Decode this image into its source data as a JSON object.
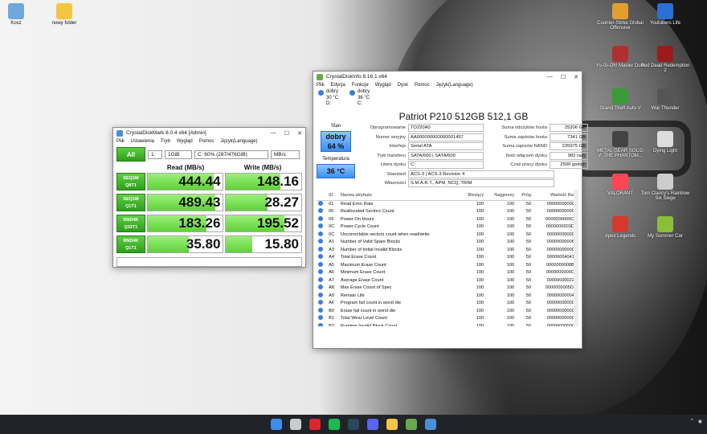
{
  "desktop": {
    "left_icons": [
      {
        "label": "Kosz",
        "color": "#6fa8dc"
      },
      {
        "label": "nowy folder",
        "color": "#f4c542"
      }
    ],
    "right_icons": [
      {
        "label": "Counter-Strike Global Offensive",
        "color": "#e0a030"
      },
      {
        "label": "Youtubers Life",
        "color": "#2b6fd8"
      },
      {
        "label": "Yu-Gi-Oh! Master Duel",
        "color": "#b03030"
      },
      {
        "label": "Red Dead Redemption 2",
        "color": "#9b1b1b"
      },
      {
        "label": "Grand Theft Auto V",
        "color": "#3a9a3a"
      },
      {
        "label": "War Thunder",
        "color": "#555555"
      },
      {
        "label": "METAL GEAR SOLID V: THE PHANTOM...",
        "color": "#444444"
      },
      {
        "label": "Dying Light",
        "color": "#dddddd"
      },
      {
        "label": "VALORANT",
        "color": "#ff4655"
      },
      {
        "label": "Tom Clancy's Rainbow Six Siege",
        "color": "#cccccc"
      },
      {
        "label": "Apex Legends",
        "color": "#d33a2c"
      },
      {
        "label": "My Summer Car",
        "color": "#8bbf3a"
      }
    ]
  },
  "cdm": {
    "title": "CrystalDiskMark 8.0.4 x64 [Admin]",
    "menu": [
      "Plik",
      "Ustawienia",
      "Tryb",
      "Wygląd",
      "Pomoc",
      "Język(Language)"
    ],
    "count": "1",
    "size": "1GiB",
    "drive": "C: 60% (287/476GiB)",
    "unit": "MB/s",
    "all_label": "All",
    "read_header": "Read (MB/s)",
    "write_header": "Write (MB/s)",
    "tests": [
      {
        "line1": "SEQ1M",
        "line2": "Q8T1",
        "read": "444.44",
        "write": "148.16",
        "read_fill": 0.88,
        "write_fill": 0.72
      },
      {
        "line1": "SEQ1M",
        "line2": "Q1T1",
        "read": "489.43",
        "write": "28.27",
        "read_fill": 0.9,
        "write_fill": 0.55
      },
      {
        "line1": "RND4K",
        "line2": "Q32T1",
        "read": "183.26",
        "write": "195.52",
        "read_fill": 0.78,
        "write_fill": 0.78
      },
      {
        "line1": "RND4K",
        "line2": "Q1T1",
        "read": "35.80",
        "write": "15.80",
        "read_fill": 0.55,
        "write_fill": 0.35
      }
    ]
  },
  "cdi": {
    "title": "CrystalDiskInfo 8.16.1 x64",
    "menu": [
      "Plik",
      "Edycja",
      "Funkcje",
      "Wygląd",
      "Dysk",
      "Pomoc",
      "Język(Language)"
    ],
    "drives": [
      {
        "status": "dobry",
        "temp": "30 °C",
        "letter": "D:"
      },
      {
        "status": "dobry",
        "temp": "36 °C",
        "letter": "C:"
      }
    ],
    "drive_title": "Patriot P210 512GB 512,1 GB",
    "stan_label": "Stan",
    "health_text": "dobry",
    "health_pct": "64 %",
    "temp_label": "Temperatura",
    "temp_value": "36 °C",
    "info": [
      {
        "label": "Oprogramowanie",
        "value": "TO220A0"
      },
      {
        "label": "Numer seryjny",
        "value": "AA000000000000001457"
      },
      {
        "label": "Interfejs",
        "value": "Serial ATA"
      },
      {
        "label": "Tryb transferu",
        "value": "SATA/600 | SATA/600"
      },
      {
        "label": "Litera dysku",
        "value": "C:"
      }
    ],
    "right_info": [
      {
        "label": "Suma odczytów hosta",
        "value": "25206 GB"
      },
      {
        "label": "Suma zapisów hosta",
        "value": "7341 GB"
      },
      {
        "label": "Suma zapisów NAND",
        "value": "235975 GB"
      },
      {
        "label": "Ilość włączeń dysku",
        "value": "982 razy"
      },
      {
        "label": "Czas pracy dysku",
        "value": "2506 godzin"
      }
    ],
    "standard_label": "Standard",
    "standard_value": "ACS-3 | ACS-3 Revision 4",
    "features_label": "Własności",
    "features_value": "S.M.A.R.T., APM, NCQ, TRIM",
    "columns": [
      "ID",
      "Nazwa atrybutu",
      "Bieżący",
      "Najgorszy",
      "Próg",
      "Wartość Raw"
    ],
    "attributes": [
      {
        "id": "01",
        "name": "Read Error Rate",
        "cur": "100",
        "worst": "100",
        "thr": "50",
        "raw": "000000000000"
      },
      {
        "id": "05",
        "name": "Reallocated Sectors Count",
        "cur": "100",
        "worst": "100",
        "thr": "50",
        "raw": "000000000000"
      },
      {
        "id": "09",
        "name": "Power-On Hours",
        "cur": "100",
        "worst": "100",
        "thr": "50",
        "raw": "0000000009CA"
      },
      {
        "id": "0C",
        "name": "Power Cycle Count",
        "cur": "100",
        "worst": "100",
        "thr": "50",
        "raw": "0000000003D6"
      },
      {
        "id": "0C",
        "name": "Uncorrectable sectors count when read/write",
        "cur": "100",
        "worst": "100",
        "thr": "50",
        "raw": "000000000000"
      },
      {
        "id": "A1",
        "name": "Number of Valid Spare Blocks",
        "cur": "100",
        "worst": "100",
        "thr": "50",
        "raw": "000000000064"
      },
      {
        "id": "A3",
        "name": "Number of Initial Invalid Blocks",
        "cur": "100",
        "worst": "100",
        "thr": "50",
        "raw": "000000000009"
      },
      {
        "id": "A4",
        "name": "Total Erase Count",
        "cur": "100",
        "worst": "100",
        "thr": "50",
        "raw": "000000040419"
      },
      {
        "id": "A5",
        "name": "Maximum Erase Count",
        "cur": "100",
        "worst": "100",
        "thr": "50",
        "raw": "0000000008B8"
      },
      {
        "id": "A6",
        "name": "Minimum Erase Count",
        "cur": "100",
        "worst": "100",
        "thr": "50",
        "raw": "0000000000C6"
      },
      {
        "id": "A7",
        "name": "Average Erase Count",
        "cur": "100",
        "worst": "100",
        "thr": "50",
        "raw": "000000000222"
      },
      {
        "id": "A8",
        "name": "Max Erase Count of Spec",
        "cur": "100",
        "worst": "100",
        "thr": "50",
        "raw": "0000000005DC"
      },
      {
        "id": "A9",
        "name": "Remain Life",
        "cur": "100",
        "worst": "100",
        "thr": "50",
        "raw": "000000000040"
      },
      {
        "id": "AF",
        "name": "Program fail count in worst die",
        "cur": "100",
        "worst": "100",
        "thr": "50",
        "raw": "000000000000"
      },
      {
        "id": "B0",
        "name": "Erase fail count in worst die",
        "cur": "100",
        "worst": "100",
        "thr": "50",
        "raw": "000000000000"
      },
      {
        "id": "B1",
        "name": "Total Wear Level Count",
        "cur": "100",
        "worst": "100",
        "thr": "50",
        "raw": "000000000000"
      },
      {
        "id": "B2",
        "name": "Runtime Invalid Block Count",
        "cur": "100",
        "worst": "100",
        "thr": "50",
        "raw": "000000000000"
      },
      {
        "id": "B5",
        "name": "Total Program Fail Count",
        "cur": "100",
        "worst": "100",
        "thr": "50",
        "raw": "000000000000"
      }
    ]
  },
  "taskbar": {
    "apps": [
      {
        "name": "start-icon",
        "color": "#3b8eea"
      },
      {
        "name": "search-icon",
        "color": "#cccccc"
      },
      {
        "name": "opera-icon",
        "color": "#e0242f"
      },
      {
        "name": "spotify-icon",
        "color": "#1db954"
      },
      {
        "name": "steam-icon",
        "color": "#2a475e"
      },
      {
        "name": "discord-icon",
        "color": "#5865f2"
      },
      {
        "name": "explorer-icon",
        "color": "#f4c542"
      },
      {
        "name": "crystaldiskinfo-icon",
        "color": "#6aa84f"
      },
      {
        "name": "crystaldiskmark-icon",
        "color": "#4a8fd8"
      }
    ]
  }
}
